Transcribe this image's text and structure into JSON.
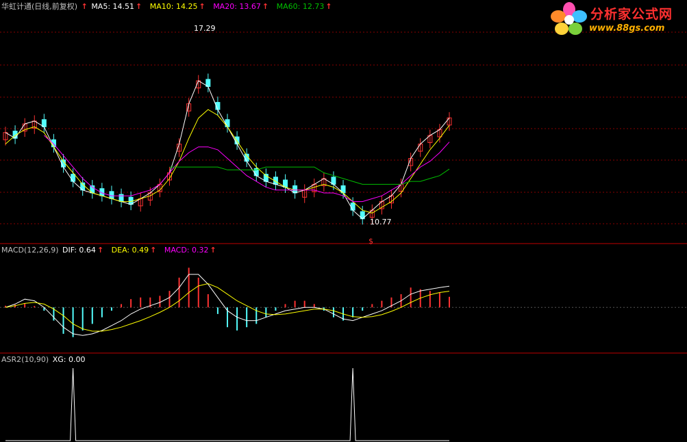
{
  "panel_main": {
    "name": "华虹计通(日线,前复权)",
    "ma5_label": "MA5: 14.51",
    "ma10_label": "MA10: 14.25",
    "ma20_label": "MA20: 13.67",
    "ma60_label": "MA60: 12.73",
    "arrow": "↑",
    "high_label": "17.29",
    "low_label": "10.77",
    "s_label": "$"
  },
  "panel_macd": {
    "name": "MACD(12,26,9)",
    "dif_label": "DIF: 0.64",
    "dea_label": "DEA: 0.49",
    "macd_label": "MACD: 0.32"
  },
  "panel_asr": {
    "name": "ASR2(10,90)",
    "xg_label": "XG: 0.00"
  },
  "logo": {
    "title": "分析家公式网",
    "url": "www.88gs.com"
  },
  "colors": {
    "up": "#ff3232",
    "down": "#54ffff",
    "ma5": "#ffffff",
    "ma10": "#ffff00",
    "ma20": "#ff00ff",
    "ma60": "#00c000",
    "grid": "#8b0000",
    "divider": "#c00000",
    "text": "#c0c0c0"
  },
  "chart_data": [
    {
      "type": "line",
      "panel": "price",
      "ylim": [
        10.4,
        17.8
      ],
      "series": [
        {
          "name": "MA5",
          "values": [
            14.0,
            13.8,
            14.3,
            14.4,
            14.2,
            13.5,
            12.8,
            12.3,
            12.0,
            11.9,
            11.8,
            11.7,
            11.6,
            11.5,
            11.7,
            11.9,
            12.2,
            12.6,
            13.6,
            15.0,
            15.8,
            15.6,
            14.8,
            14.2,
            13.6,
            13.0,
            12.5,
            12.3,
            12.2,
            12.1,
            11.9,
            12.0,
            12.2,
            12.4,
            12.2,
            11.9,
            11.3,
            11.0,
            11.3,
            11.6,
            11.8,
            12.2,
            13.1,
            13.6,
            13.9,
            14.1,
            14.51
          ]
        },
        {
          "name": "MA10",
          "values": [
            13.6,
            13.9,
            14.1,
            14.2,
            14.0,
            13.5,
            13.0,
            12.6,
            12.2,
            11.9,
            11.8,
            11.7,
            11.6,
            11.6,
            11.7,
            11.8,
            12.0,
            12.4,
            13.0,
            13.8,
            14.5,
            14.8,
            14.6,
            14.2,
            13.7,
            13.2,
            12.8,
            12.5,
            12.3,
            12.1,
            12.0,
            12.0,
            12.1,
            12.2,
            12.1,
            11.9,
            11.6,
            11.3,
            11.2,
            11.4,
            11.6,
            11.9,
            12.4,
            12.9,
            13.4,
            13.8,
            14.25
          ]
        },
        {
          "name": "MA20",
          "values": [
            null,
            null,
            null,
            null,
            13.9,
            13.6,
            13.2,
            12.8,
            12.4,
            12.1,
            11.9,
            11.8,
            11.8,
            11.8,
            11.9,
            12.0,
            12.2,
            12.6,
            13.0,
            13.3,
            13.5,
            13.5,
            13.4,
            13.1,
            12.8,
            12.5,
            12.3,
            12.1,
            12.0,
            12.0,
            12.0,
            12.0,
            12.0,
            11.9,
            11.9,
            11.8,
            11.6,
            11.6,
            11.7,
            11.8,
            12.0,
            12.2,
            12.5,
            12.8,
            13.0,
            13.3,
            13.67
          ]
        },
        {
          "name": "MA60",
          "values": [
            null,
            null,
            null,
            null,
            null,
            null,
            null,
            null,
            null,
            null,
            null,
            null,
            null,
            null,
            null,
            null,
            null,
            12.8,
            12.8,
            12.8,
            12.8,
            12.8,
            12.8,
            12.7,
            12.7,
            12.7,
            12.7,
            12.8,
            12.8,
            12.8,
            12.8,
            12.8,
            12.8,
            12.6,
            12.5,
            12.4,
            12.3,
            12.2,
            12.2,
            12.2,
            12.2,
            12.2,
            12.3,
            12.3,
            12.4,
            12.5,
            12.73
          ]
        }
      ],
      "annotations": [
        "17.29",
        "10.77"
      ]
    },
    {
      "type": "bar",
      "panel": "macd",
      "ylim": [
        -1.3,
        1.6
      ],
      "macd_hist": [
        0.05,
        0.08,
        0.12,
        0.04,
        -0.1,
        -0.4,
        -0.8,
        -0.9,
        -0.7,
        -0.5,
        -0.3,
        -0.1,
        0.1,
        0.25,
        0.3,
        0.3,
        0.35,
        0.5,
        0.9,
        1.2,
        0.9,
        0.4,
        -0.2,
        -0.6,
        -0.7,
        -0.6,
        -0.5,
        -0.3,
        -0.1,
        0.1,
        0.2,
        0.2,
        0.1,
        -0.1,
        -0.3,
        -0.4,
        -0.3,
        -0.1,
        0.1,
        0.2,
        0.3,
        0.4,
        0.6,
        0.55,
        0.5,
        0.45,
        0.32
      ],
      "series": [
        {
          "name": "DIF",
          "values": [
            0.0,
            0.1,
            0.25,
            0.2,
            0.0,
            -0.3,
            -0.6,
            -0.8,
            -0.85,
            -0.8,
            -0.7,
            -0.55,
            -0.4,
            -0.2,
            -0.05,
            0.05,
            0.15,
            0.3,
            0.6,
            1.0,
            1.0,
            0.7,
            0.3,
            -0.1,
            -0.3,
            -0.4,
            -0.4,
            -0.3,
            -0.2,
            -0.1,
            -0.05,
            0.0,
            0.0,
            -0.05,
            -0.2,
            -0.35,
            -0.4,
            -0.3,
            -0.2,
            -0.1,
            0.05,
            0.2,
            0.4,
            0.5,
            0.55,
            0.6,
            0.64
          ]
        },
        {
          "name": "DEA",
          "values": [
            0.0,
            0.05,
            0.12,
            0.15,
            0.1,
            -0.05,
            -0.25,
            -0.5,
            -0.65,
            -0.72,
            -0.72,
            -0.67,
            -0.6,
            -0.5,
            -0.4,
            -0.28,
            -0.15,
            0.0,
            0.2,
            0.45,
            0.65,
            0.72,
            0.6,
            0.4,
            0.2,
            0.05,
            -0.1,
            -0.2,
            -0.22,
            -0.2,
            -0.15,
            -0.1,
            -0.05,
            -0.05,
            -0.1,
            -0.2,
            -0.28,
            -0.3,
            -0.28,
            -0.22,
            -0.12,
            0.0,
            0.15,
            0.28,
            0.38,
            0.45,
            0.49
          ]
        }
      ]
    },
    {
      "type": "line",
      "panel": "asr2",
      "ylim": [
        0,
        1
      ],
      "series": [
        {
          "name": "XG",
          "values": [
            0,
            0,
            0,
            0,
            0,
            0,
            0,
            1,
            0,
            0,
            0,
            0,
            0,
            0,
            0,
            0,
            0,
            0,
            0,
            0,
            0,
            0,
            0,
            0,
            0,
            0,
            0,
            0,
            0,
            0,
            0,
            0,
            0,
            0,
            0,
            0,
            1,
            0,
            0,
            0,
            0,
            0,
            0,
            0,
            0,
            0,
            0
          ]
        }
      ]
    }
  ]
}
